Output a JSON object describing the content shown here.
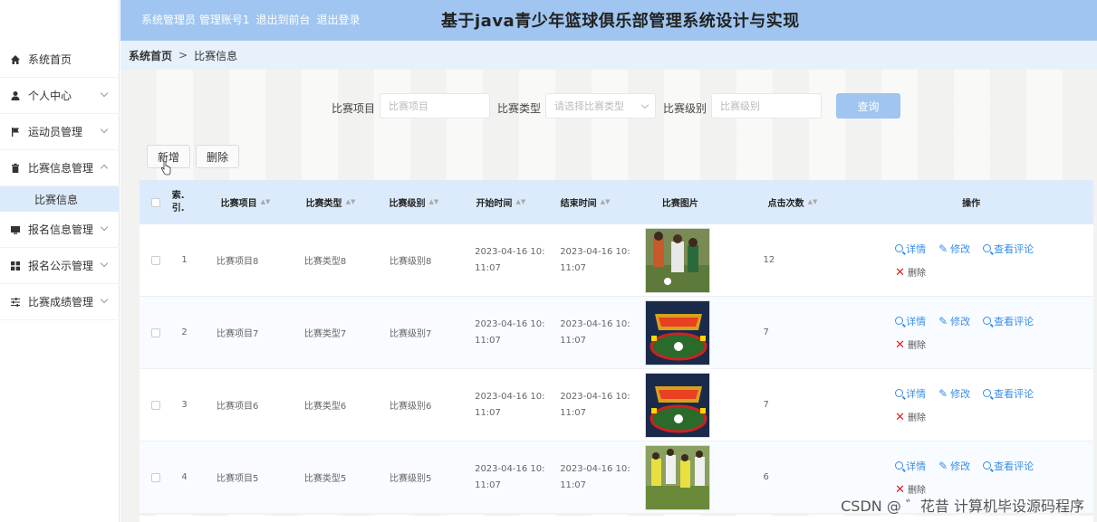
{
  "header": {
    "links": [
      "系统管理员 管理账号1",
      "退出到前台",
      "退出登录"
    ],
    "title": "基于java青少年篮球俱乐部管理系统设计与实现"
  },
  "sidebar": {
    "items": [
      {
        "label": "系统首页",
        "icon": "home-icon"
      },
      {
        "label": "个人中心",
        "icon": "user-icon"
      },
      {
        "label": "运动员管理",
        "icon": "flag-icon"
      },
      {
        "label": "比赛信息管理",
        "icon": "trash-can-icon"
      },
      {
        "label": "报名信息管理",
        "icon": "monitor-icon"
      },
      {
        "label": "报名公示管理",
        "icon": "grid-icon"
      },
      {
        "label": "比赛成绩管理",
        "icon": "sliders-icon"
      }
    ],
    "submenu": {
      "label": "比赛信息"
    }
  },
  "breadcrumb": {
    "home": "系统首页",
    "sep": ">",
    "current": "比赛信息"
  },
  "search": {
    "project_label": "比赛项目",
    "project_placeholder": "比赛项目",
    "type_label": "比赛类型",
    "type_placeholder": "请选择比赛类型",
    "level_label": "比赛级别",
    "level_placeholder": "比赛级别",
    "query_button": "查询"
  },
  "actions": {
    "add": "新增",
    "delete": "删除"
  },
  "table": {
    "columns": [
      "索.引.",
      "比赛项目",
      "比赛类型",
      "比赛级别",
      "开始时间",
      "结束时间",
      "比赛图片",
      "点击次数",
      "操作"
    ],
    "op_labels": {
      "detail": "详情",
      "edit": "修改",
      "comments": "查看评论",
      "delete": "删除"
    },
    "rows": [
      {
        "index": "1",
        "project": "比赛项目8",
        "type": "比赛类型8",
        "level": "比赛级别8",
        "start_l1": "2023-04-16 10:",
        "start_l2": "11:07",
        "end_l1": "2023-04-16 10:",
        "end_l2": "11:07",
        "clicks": "12"
      },
      {
        "index": "2",
        "project": "比赛项目7",
        "type": "比赛类型7",
        "level": "比赛级别7",
        "start_l1": "2023-04-16 10:",
        "start_l2": "11:07",
        "end_l1": "2023-04-16 10:",
        "end_l2": "11:07",
        "clicks": "7"
      },
      {
        "index": "3",
        "project": "比赛项目6",
        "type": "比赛类型6",
        "level": "比赛级别6",
        "start_l1": "2023-04-16 10:",
        "start_l2": "11:07",
        "end_l1": "2023-04-16 10:",
        "end_l2": "11:07",
        "clicks": "7"
      },
      {
        "index": "4",
        "project": "比赛项目5",
        "type": "比赛类型5",
        "level": "比赛级别5",
        "start_l1": "2023-04-16 10:",
        "start_l2": "11:07",
        "end_l1": "2023-04-16 10:",
        "end_l2": "11:07",
        "clicks": "6"
      }
    ]
  },
  "watermark": "CSDN @ ゛花昔 计算机毕设源码程序"
}
